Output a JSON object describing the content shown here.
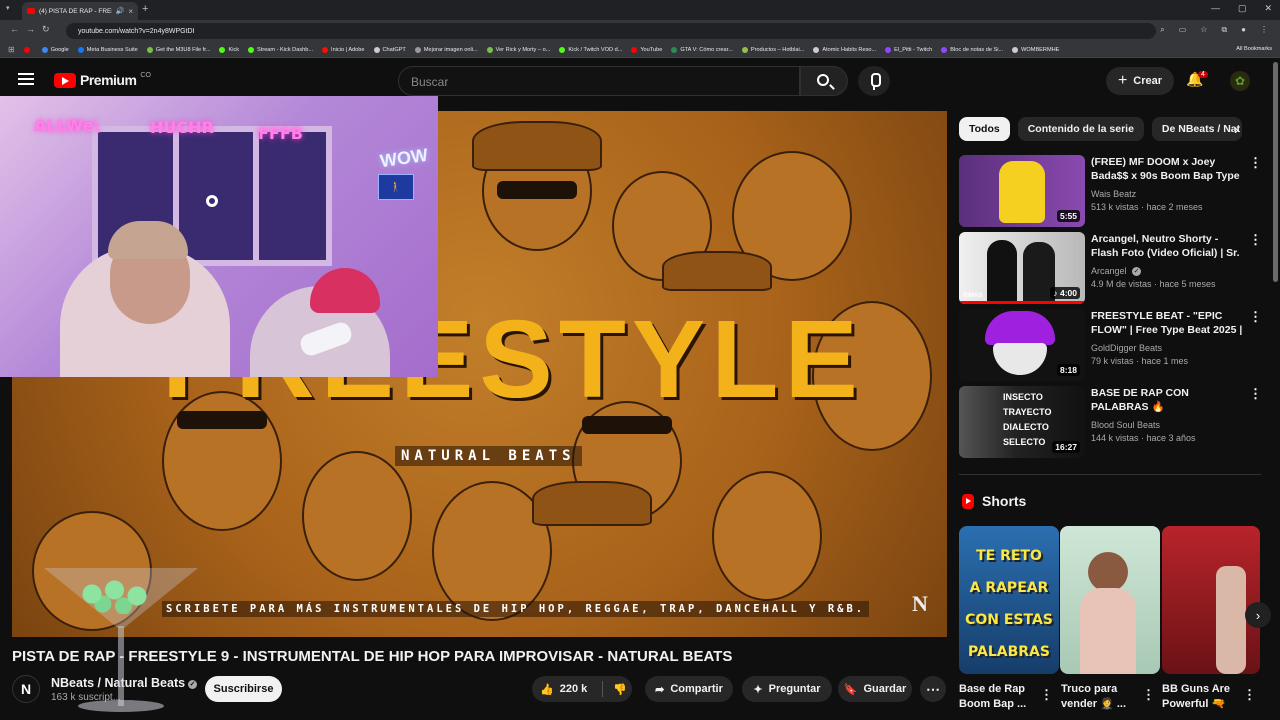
{
  "browser": {
    "tab_title": "(4) PISTA DE RAP - FREESTYLE",
    "url": "youtube.com/watch?v=2n4y8WPGtDI",
    "bookmarks": [
      {
        "label": "",
        "color": "#ff0000"
      },
      {
        "label": "Google",
        "color": "#4285f4"
      },
      {
        "label": "Meta Business Suite",
        "color": "#1877f2"
      },
      {
        "label": "Get the M3U8 File fr...",
        "color": "#7bc043"
      },
      {
        "label": "Kick",
        "color": "#53fc18"
      },
      {
        "label": "Stream - Kick Dashb...",
        "color": "#53fc18"
      },
      {
        "label": "Inicio | Adobe",
        "color": "#fa0f00"
      },
      {
        "label": "ChatGPT",
        "color": "#cccccc"
      },
      {
        "label": "Mejorar imagen onli...",
        "color": "#9a9a9a"
      },
      {
        "label": "Ver Rick y Morty – o...",
        "color": "#7bc043"
      },
      {
        "label": "Kick / Twitch VOD d...",
        "color": "#53fc18"
      },
      {
        "label": "YouTube",
        "color": "#ff0000"
      },
      {
        "label": "GTA V: Cómo crear...",
        "color": "#2e8b57"
      },
      {
        "label": "Productos – Hotblai...",
        "color": "#96bf48"
      },
      {
        "label": "Atomic Habits Reso...",
        "color": "#cccccc"
      },
      {
        "label": "El_Pitti - Twitch",
        "color": "#9146ff"
      },
      {
        "label": "Bloc de notas de Si...",
        "color": "#9146ff"
      },
      {
        "label": "WOMBERMHE",
        "color": "#cccccc"
      }
    ],
    "all_bookmarks": "All Bookmarks"
  },
  "header": {
    "logo": "Premium",
    "country": "CO",
    "search_placeholder": "Buscar",
    "create": "Crear",
    "notifications": "4"
  },
  "player": {
    "artwork_title": "FREESTYLE",
    "artwork_subtitle": "NATURAL BEATS",
    "artwork_footer": "SCRIBETE PARA MÁS INSTRUMENTALES DE HIP HOP, REGGAE, TRAP, DANCEHALL Y R&B.",
    "watermark": "N"
  },
  "video": {
    "title": "PISTA DE RAP - FREESTYLE 9 - INSTRUMENTAL DE HIP HOP PARA IMPROVISAR - NATURAL BEATS",
    "channel": "NBeats / Natural Beats",
    "channel_initial": "N",
    "subscribers": "163 k suscript...",
    "subscribe": "Suscribirse",
    "likes": "220 k",
    "share": "Compartir",
    "ask": "Preguntar",
    "save": "Guardar"
  },
  "sidebar": {
    "chips": [
      "Todos",
      "Contenido de la serie",
      "De NBeats / Nat"
    ],
    "videos": [
      {
        "title": "(FREE) MF DOOM x Joey Bada$$ x 90s Boom Bap Type ...",
        "channel": "Wais Beatz",
        "meta": "513 k vistas · hace 2 meses",
        "duration": "5:55",
        "thumb_color": "#6a3a8a"
      },
      {
        "title": "Arcangel, Neutro Shorty - Flash Foto (Video Oficial) | Sr. Santo...",
        "channel": "Arcangel",
        "meta": "4.9 M de vistas · hace 5 meses",
        "duration": "4:00",
        "thumb_color": "#d8d8d8"
      },
      {
        "title": "FREESTYLE BEAT - \"EPIC FLOW\" | Free Type Beat 2025 | Rap Tr...",
        "channel": "GoldDigger Beats",
        "meta": "79 k vistas · hace 1 mes",
        "duration": "8:18",
        "thumb_color": "#1a1a1a"
      },
      {
        "title": "BASE DE RAP CON PALABRAS 🔥 ENTRENAMIENTO PARA ...",
        "channel": "Blood Soul Beats",
        "meta": "144 k vistas · hace 3 años",
        "duration": "16:27",
        "thumb_color": "#2a2a2a"
      }
    ],
    "thumb4_text": [
      "INSECTO",
      "TRAYECTO",
      "DIALECTO",
      "SELECTO"
    ],
    "thumb2_label": "RIMAS",
    "shorts_title": "Shorts",
    "shorts": [
      {
        "caption": "Base de Rap Boom Bap ...",
        "text": [
          "TE RETO",
          "A RAPEAR",
          "CON ESTAS",
          "PALABRAS"
        ]
      },
      {
        "caption": "Truco para vender 🤵 ..."
      },
      {
        "caption": "BB Guns Are Powerful 🔫"
      }
    ]
  },
  "webcam": {
    "neon_left": "ALLWe\\",
    "neon_mid": "HUCHR",
    "neon_right": "FFFB",
    "neon_corner": "WOW",
    "exit_sign": "🚶"
  }
}
